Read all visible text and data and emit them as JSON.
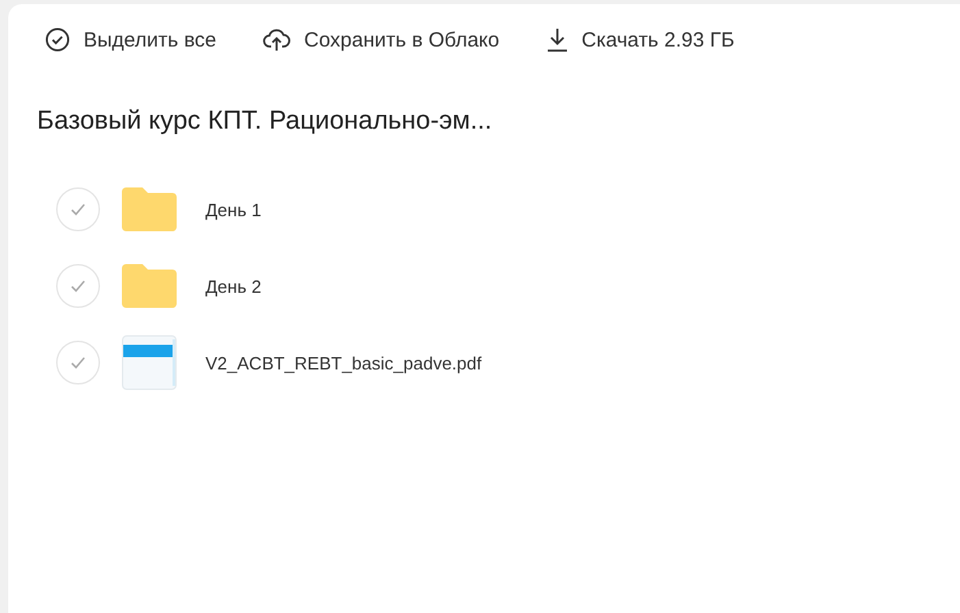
{
  "toolbar": [
    {
      "kind": "select",
      "label": "Выделить все"
    },
    {
      "kind": "cloud",
      "label": "Сохранить в Облако"
    },
    {
      "kind": "download",
      "label": "Скачать 2.93 ГБ"
    }
  ],
  "title": "Базовый курс КПТ. Рационально-эм...",
  "items": [
    {
      "kind": "folder",
      "name": "День 1",
      "checked": false
    },
    {
      "kind": "folder",
      "name": "День 2",
      "checked": false
    },
    {
      "kind": "file",
      "name": "V2_ACBT_REBT_basic_padve.pdf",
      "checked": false
    }
  ]
}
